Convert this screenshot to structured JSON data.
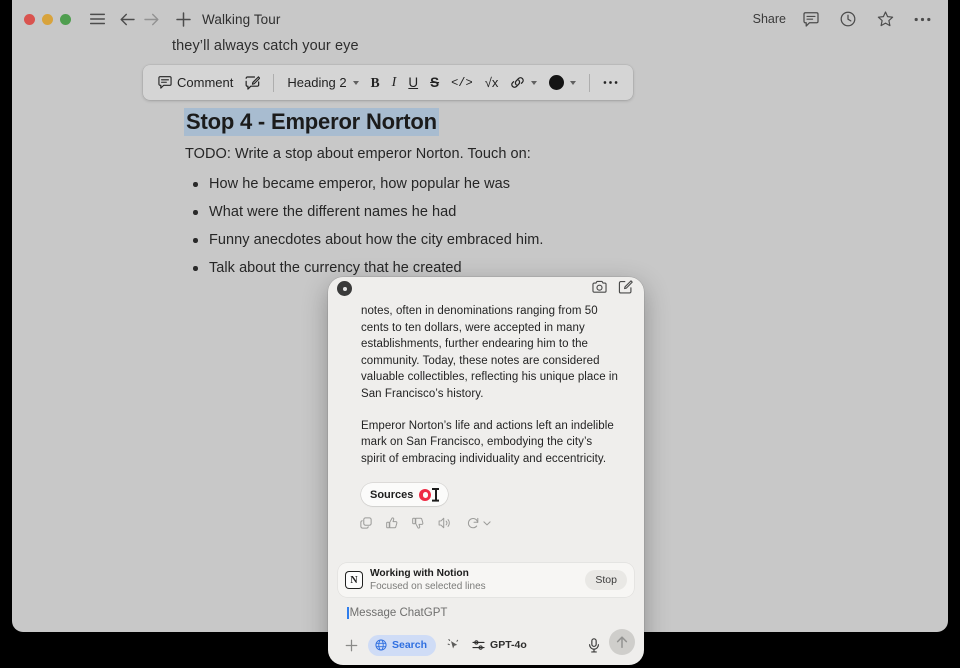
{
  "window": {
    "title": "Walking Tour",
    "titlebar": {
      "share_label": "Share",
      "icons": [
        "hamburger-icon",
        "back-arrow-icon",
        "forward-arrow-icon",
        "plus-icon",
        "comment-icon",
        "history-icon",
        "star-icon",
        "more-icon"
      ]
    }
  },
  "toolbar": {
    "comment_label": "Comment",
    "suggest_icon": "suggest-edit-icon",
    "block_type": "Heading 2",
    "bold": "B",
    "italic": "I",
    "underline": "U",
    "strikethrough": "S",
    "code": "</>",
    "equation": "√x",
    "link_icon": "link-icon",
    "color_swatch_hex": "#141414",
    "more": "•••"
  },
  "document": {
    "previous_line": "they’ll always catch your eye",
    "heading": "Stop 4 - Emperor Norton",
    "heading_highlight_hex": "#a8bcd0",
    "todo_line": "TODO: Write a stop about emperor Norton. Touch on:",
    "bullets": [
      "How he became emperor, how popular he was",
      "What were the different names he had",
      "Funny anecdotes about how the city embraced him.",
      "Talk about the currency that he created"
    ]
  },
  "chat_panel": {
    "header": {
      "close_icon": "close-icon",
      "screenshot_icon": "screenshot-icon",
      "new_chat_icon": "new-chat-icon"
    },
    "message": {
      "paragraph_1": "notes, often in denominations ranging from 50 cents to ten dollars, were accepted in many establishments, further endearing him to the community. Today, these notes are considered valuable collectibles, reflecting his unique place in San Francisco’s history.",
      "paragraph_2": "Emperor Norton’s life and actions left an indelible mark on San Francisco, embodying the city’s spirit of embracing individuality and eccentricity.",
      "sources_label": "Sources",
      "sources_favicon_hex": "#ee2b45",
      "actions": [
        "copy-icon",
        "thumbs-up-icon",
        "thumbs-down-icon",
        "read-aloud-icon",
        "regenerate-icon",
        "chevron-down-icon"
      ]
    },
    "working_bar": {
      "app_icon": "notion-icon",
      "app_icon_letter": "N",
      "title": "Working with Notion",
      "subtitle": "Focused on selected lines",
      "stop_label": "Stop"
    },
    "composer": {
      "placeholder": "Message ChatGPT",
      "caret_hex": "#2f7dec",
      "attach_label": "+",
      "search_label": "Search",
      "search_pill_hex": "#cfdcf6",
      "search_text_hex": "#2f6fe0",
      "ai_cursor_icon": "ai-cursor-icon",
      "model_label": "GPT-4o",
      "mic_icon": "microphone-icon",
      "send_icon": "send-arrow-icon"
    }
  }
}
